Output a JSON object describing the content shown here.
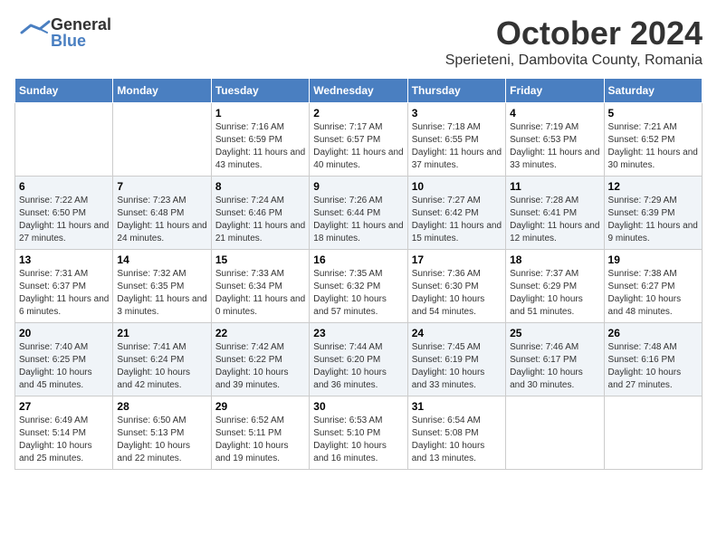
{
  "header": {
    "logo_general": "General",
    "logo_blue": "Blue",
    "month_title": "October 2024",
    "subtitle": "Sperieteni, Dambovita County, Romania"
  },
  "days_of_week": [
    "Sunday",
    "Monday",
    "Tuesday",
    "Wednesday",
    "Thursday",
    "Friday",
    "Saturday"
  ],
  "weeks": [
    [
      {
        "day": "",
        "sunrise": "",
        "sunset": "",
        "daylight": ""
      },
      {
        "day": "",
        "sunrise": "",
        "sunset": "",
        "daylight": ""
      },
      {
        "day": "1",
        "sunrise": "Sunrise: 7:16 AM",
        "sunset": "Sunset: 6:59 PM",
        "daylight": "Daylight: 11 hours and 43 minutes."
      },
      {
        "day": "2",
        "sunrise": "Sunrise: 7:17 AM",
        "sunset": "Sunset: 6:57 PM",
        "daylight": "Daylight: 11 hours and 40 minutes."
      },
      {
        "day": "3",
        "sunrise": "Sunrise: 7:18 AM",
        "sunset": "Sunset: 6:55 PM",
        "daylight": "Daylight: 11 hours and 37 minutes."
      },
      {
        "day": "4",
        "sunrise": "Sunrise: 7:19 AM",
        "sunset": "Sunset: 6:53 PM",
        "daylight": "Daylight: 11 hours and 33 minutes."
      },
      {
        "day": "5",
        "sunrise": "Sunrise: 7:21 AM",
        "sunset": "Sunset: 6:52 PM",
        "daylight": "Daylight: 11 hours and 30 minutes."
      }
    ],
    [
      {
        "day": "6",
        "sunrise": "Sunrise: 7:22 AM",
        "sunset": "Sunset: 6:50 PM",
        "daylight": "Daylight: 11 hours and 27 minutes."
      },
      {
        "day": "7",
        "sunrise": "Sunrise: 7:23 AM",
        "sunset": "Sunset: 6:48 PM",
        "daylight": "Daylight: 11 hours and 24 minutes."
      },
      {
        "day": "8",
        "sunrise": "Sunrise: 7:24 AM",
        "sunset": "Sunset: 6:46 PM",
        "daylight": "Daylight: 11 hours and 21 minutes."
      },
      {
        "day": "9",
        "sunrise": "Sunrise: 7:26 AM",
        "sunset": "Sunset: 6:44 PM",
        "daylight": "Daylight: 11 hours and 18 minutes."
      },
      {
        "day": "10",
        "sunrise": "Sunrise: 7:27 AM",
        "sunset": "Sunset: 6:42 PM",
        "daylight": "Daylight: 11 hours and 15 minutes."
      },
      {
        "day": "11",
        "sunrise": "Sunrise: 7:28 AM",
        "sunset": "Sunset: 6:41 PM",
        "daylight": "Daylight: 11 hours and 12 minutes."
      },
      {
        "day": "12",
        "sunrise": "Sunrise: 7:29 AM",
        "sunset": "Sunset: 6:39 PM",
        "daylight": "Daylight: 11 hours and 9 minutes."
      }
    ],
    [
      {
        "day": "13",
        "sunrise": "Sunrise: 7:31 AM",
        "sunset": "Sunset: 6:37 PM",
        "daylight": "Daylight: 11 hours and 6 minutes."
      },
      {
        "day": "14",
        "sunrise": "Sunrise: 7:32 AM",
        "sunset": "Sunset: 6:35 PM",
        "daylight": "Daylight: 11 hours and 3 minutes."
      },
      {
        "day": "15",
        "sunrise": "Sunrise: 7:33 AM",
        "sunset": "Sunset: 6:34 PM",
        "daylight": "Daylight: 11 hours and 0 minutes."
      },
      {
        "day": "16",
        "sunrise": "Sunrise: 7:35 AM",
        "sunset": "Sunset: 6:32 PM",
        "daylight": "Daylight: 10 hours and 57 minutes."
      },
      {
        "day": "17",
        "sunrise": "Sunrise: 7:36 AM",
        "sunset": "Sunset: 6:30 PM",
        "daylight": "Daylight: 10 hours and 54 minutes."
      },
      {
        "day": "18",
        "sunrise": "Sunrise: 7:37 AM",
        "sunset": "Sunset: 6:29 PM",
        "daylight": "Daylight: 10 hours and 51 minutes."
      },
      {
        "day": "19",
        "sunrise": "Sunrise: 7:38 AM",
        "sunset": "Sunset: 6:27 PM",
        "daylight": "Daylight: 10 hours and 48 minutes."
      }
    ],
    [
      {
        "day": "20",
        "sunrise": "Sunrise: 7:40 AM",
        "sunset": "Sunset: 6:25 PM",
        "daylight": "Daylight: 10 hours and 45 minutes."
      },
      {
        "day": "21",
        "sunrise": "Sunrise: 7:41 AM",
        "sunset": "Sunset: 6:24 PM",
        "daylight": "Daylight: 10 hours and 42 minutes."
      },
      {
        "day": "22",
        "sunrise": "Sunrise: 7:42 AM",
        "sunset": "Sunset: 6:22 PM",
        "daylight": "Daylight: 10 hours and 39 minutes."
      },
      {
        "day": "23",
        "sunrise": "Sunrise: 7:44 AM",
        "sunset": "Sunset: 6:20 PM",
        "daylight": "Daylight: 10 hours and 36 minutes."
      },
      {
        "day": "24",
        "sunrise": "Sunrise: 7:45 AM",
        "sunset": "Sunset: 6:19 PM",
        "daylight": "Daylight: 10 hours and 33 minutes."
      },
      {
        "day": "25",
        "sunrise": "Sunrise: 7:46 AM",
        "sunset": "Sunset: 6:17 PM",
        "daylight": "Daylight: 10 hours and 30 minutes."
      },
      {
        "day": "26",
        "sunrise": "Sunrise: 7:48 AM",
        "sunset": "Sunset: 6:16 PM",
        "daylight": "Daylight: 10 hours and 27 minutes."
      }
    ],
    [
      {
        "day": "27",
        "sunrise": "Sunrise: 6:49 AM",
        "sunset": "Sunset: 5:14 PM",
        "daylight": "Daylight: 10 hours and 25 minutes."
      },
      {
        "day": "28",
        "sunrise": "Sunrise: 6:50 AM",
        "sunset": "Sunset: 5:13 PM",
        "daylight": "Daylight: 10 hours and 22 minutes."
      },
      {
        "day": "29",
        "sunrise": "Sunrise: 6:52 AM",
        "sunset": "Sunset: 5:11 PM",
        "daylight": "Daylight: 10 hours and 19 minutes."
      },
      {
        "day": "30",
        "sunrise": "Sunrise: 6:53 AM",
        "sunset": "Sunset: 5:10 PM",
        "daylight": "Daylight: 10 hours and 16 minutes."
      },
      {
        "day": "31",
        "sunrise": "Sunrise: 6:54 AM",
        "sunset": "Sunset: 5:08 PM",
        "daylight": "Daylight: 10 hours and 13 minutes."
      },
      {
        "day": "",
        "sunrise": "",
        "sunset": "",
        "daylight": ""
      },
      {
        "day": "",
        "sunrise": "",
        "sunset": "",
        "daylight": ""
      }
    ]
  ]
}
